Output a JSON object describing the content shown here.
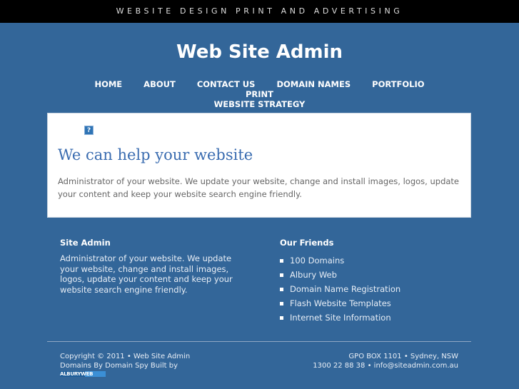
{
  "topbar": {
    "tagline": "WEBSITE DESIGN PRINT AND ADVERTISING"
  },
  "header": {
    "title": "Web Site Admin"
  },
  "nav": {
    "items": [
      "HOME",
      "ABOUT",
      "CONTACT US",
      "DOMAIN NAMES",
      "PORTFOLIO",
      "PRINT",
      "WEBSITE STRATEGY"
    ]
  },
  "main": {
    "broken_image_icon": "question-mark-icon",
    "broken_image_glyph": "?",
    "heading": "We can help your website",
    "body": "Administrator of your website. We update your website, change and install images, logos, update your content and keep your website search engine friendly."
  },
  "about": {
    "title": "Site Admin",
    "text": "Administrator of your website. We update your website, change and install images, logos, update your content and keep your website search engine friendly."
  },
  "friends": {
    "title": "Our Friends",
    "items": [
      "100 Domains",
      "Albury Web",
      "Domain Name Registration",
      "Flash Website Templates",
      "Internet Site Information"
    ]
  },
  "footer": {
    "copyright": "Copyright © 2011 • Web Site Admin",
    "built_by": "Domains By Domain Spy Built by",
    "logo_text": "ALBURYWEB",
    "address": "GPO BOX 1101 • Sydney, NSW",
    "contact": "1300 22 88 38 • info@siteadmin.com.au"
  },
  "colors": {
    "background": "#336699",
    "topbar": "#000000",
    "heading": "#3a6cb0"
  }
}
